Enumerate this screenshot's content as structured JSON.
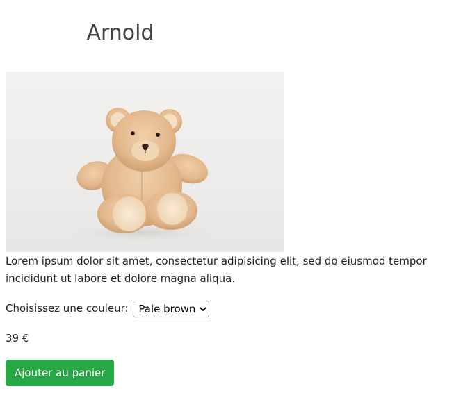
{
  "product": {
    "name": "Arnold",
    "image_subject": "teddy-bear",
    "description": "Lorem ipsum dolor sit amet, consectetur adipisicing elit, sed do eiusmod tempor incididunt ut labore et dolore magna aliqua.",
    "color_label": "Choisissez une couleur:",
    "color_selected": "Pale brown",
    "price": "39 €",
    "add_to_cart_label": "Ajouter au panier"
  },
  "colors": {
    "button_bg": "#28a745",
    "title": "#3d4348",
    "text": "#212529"
  }
}
